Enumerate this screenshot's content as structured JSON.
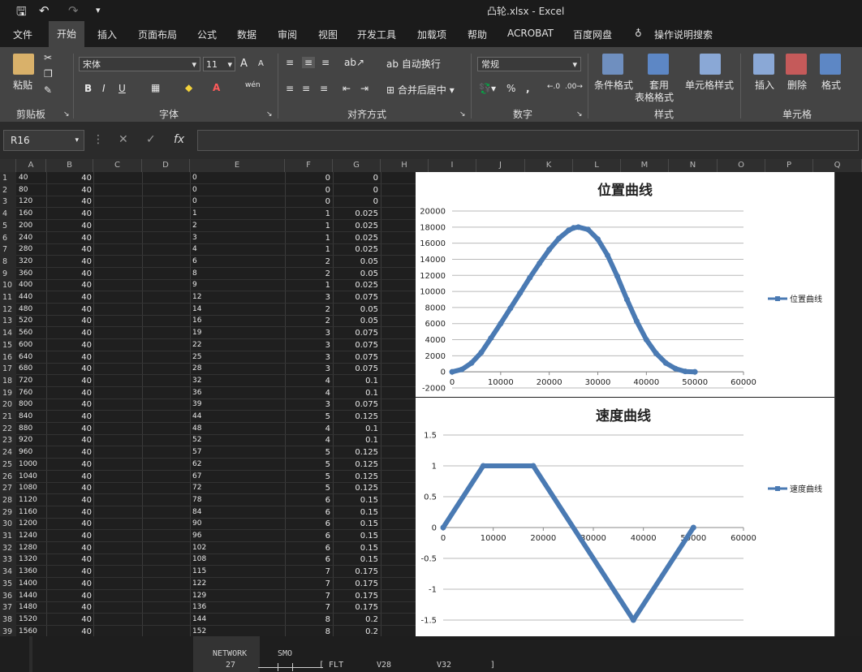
{
  "window": {
    "title": "凸轮.xlsx  -  Excel"
  },
  "tabs": [
    "文件",
    "开始",
    "插入",
    "页面布局",
    "公式",
    "数据",
    "审阅",
    "视图",
    "开发工具",
    "加载项",
    "帮助",
    "ACROBAT",
    "百度网盘",
    "操作说明搜索"
  ],
  "ribbon": {
    "clipboard": {
      "paste": "粘贴",
      "group": "剪贴板"
    },
    "font": {
      "name": "宋体",
      "size": "11",
      "group": "字体",
      "bold": "B",
      "italic": "I",
      "underline": "U",
      "grow": "A",
      "shrink": "A"
    },
    "alignment": {
      "wrap": "自动换行",
      "merge": "合并后居中",
      "group": "对齐方式"
    },
    "number": {
      "format": "常规",
      "percent": "%",
      "comma": ",",
      "group": "数字"
    },
    "styles": {
      "conditional": "条件格式",
      "table_l1": "套用",
      "table_l2": "表格格式",
      "cell_styles": "单元格样式",
      "group": "样式"
    },
    "cells": {
      "insert": "插入",
      "delete": "删除",
      "format": "格式",
      "group": "单元格"
    }
  },
  "formula_bar": {
    "name_box": "R16",
    "fx": "fx",
    "cancel": "✕",
    "enter": "✓"
  },
  "columns": [
    "A",
    "B",
    "C",
    "D",
    "E",
    "F",
    "G",
    "H",
    "I",
    "J",
    "K",
    "L",
    "M",
    "N",
    "O",
    "P",
    "Q"
  ],
  "rows": [
    {
      "n": "1",
      "a": "40",
      "b": "40",
      "e": "0",
      "f": "0",
      "g": "0"
    },
    {
      "n": "2",
      "a": "80",
      "b": "40",
      "e": "0",
      "f": "0",
      "g": "0"
    },
    {
      "n": "3",
      "a": "120",
      "b": "40",
      "e": "0",
      "f": "0",
      "g": "0"
    },
    {
      "n": "4",
      "a": "160",
      "b": "40",
      "e": "1",
      "f": "1",
      "g": "0.025"
    },
    {
      "n": "5",
      "a": "200",
      "b": "40",
      "e": "2",
      "f": "1",
      "g": "0.025"
    },
    {
      "n": "6",
      "a": "240",
      "b": "40",
      "e": "3",
      "f": "1",
      "g": "0.025"
    },
    {
      "n": "7",
      "a": "280",
      "b": "40",
      "e": "4",
      "f": "1",
      "g": "0.025"
    },
    {
      "n": "8",
      "a": "320",
      "b": "40",
      "e": "6",
      "f": "2",
      "g": "0.05"
    },
    {
      "n": "9",
      "a": "360",
      "b": "40",
      "e": "8",
      "f": "2",
      "g": "0.05"
    },
    {
      "n": "10",
      "a": "400",
      "b": "40",
      "e": "9",
      "f": "1",
      "g": "0.025"
    },
    {
      "n": "11",
      "a": "440",
      "b": "40",
      "e": "12",
      "f": "3",
      "g": "0.075"
    },
    {
      "n": "12",
      "a": "480",
      "b": "40",
      "e": "14",
      "f": "2",
      "g": "0.05"
    },
    {
      "n": "13",
      "a": "520",
      "b": "40",
      "e": "16",
      "f": "2",
      "g": "0.05"
    },
    {
      "n": "14",
      "a": "560",
      "b": "40",
      "e": "19",
      "f": "3",
      "g": "0.075"
    },
    {
      "n": "15",
      "a": "600",
      "b": "40",
      "e": "22",
      "f": "3",
      "g": "0.075"
    },
    {
      "n": "16",
      "a": "640",
      "b": "40",
      "e": "25",
      "f": "3",
      "g": "0.075"
    },
    {
      "n": "17",
      "a": "680",
      "b": "40",
      "e": "28",
      "f": "3",
      "g": "0.075"
    },
    {
      "n": "18",
      "a": "720",
      "b": "40",
      "e": "32",
      "f": "4",
      "g": "0.1"
    },
    {
      "n": "19",
      "a": "760",
      "b": "40",
      "e": "36",
      "f": "4",
      "g": "0.1"
    },
    {
      "n": "20",
      "a": "800",
      "b": "40",
      "e": "39",
      "f": "3",
      "g": "0.075"
    },
    {
      "n": "21",
      "a": "840",
      "b": "40",
      "e": "44",
      "f": "5",
      "g": "0.125"
    },
    {
      "n": "22",
      "a": "880",
      "b": "40",
      "e": "48",
      "f": "4",
      "g": "0.1"
    },
    {
      "n": "23",
      "a": "920",
      "b": "40",
      "e": "52",
      "f": "4",
      "g": "0.1"
    },
    {
      "n": "24",
      "a": "960",
      "b": "40",
      "e": "57",
      "f": "5",
      "g": "0.125"
    },
    {
      "n": "25",
      "a": "1000",
      "b": "40",
      "e": "62",
      "f": "5",
      "g": "0.125"
    },
    {
      "n": "26",
      "a": "1040",
      "b": "40",
      "e": "67",
      "f": "5",
      "g": "0.125"
    },
    {
      "n": "27",
      "a": "1080",
      "b": "40",
      "e": "72",
      "f": "5",
      "g": "0.125"
    },
    {
      "n": "28",
      "a": "1120",
      "b": "40",
      "e": "78",
      "f": "6",
      "g": "0.15"
    },
    {
      "n": "29",
      "a": "1160",
      "b": "40",
      "e": "84",
      "f": "6",
      "g": "0.15"
    },
    {
      "n": "30",
      "a": "1200",
      "b": "40",
      "e": "90",
      "f": "6",
      "g": "0.15"
    },
    {
      "n": "31",
      "a": "1240",
      "b": "40",
      "e": "96",
      "f": "6",
      "g": "0.15"
    },
    {
      "n": "32",
      "a": "1280",
      "b": "40",
      "e": "102",
      "f": "6",
      "g": "0.15"
    },
    {
      "n": "33",
      "a": "1320",
      "b": "40",
      "e": "108",
      "f": "6",
      "g": "0.15"
    },
    {
      "n": "34",
      "a": "1360",
      "b": "40",
      "e": "115",
      "f": "7",
      "g": "0.175"
    },
    {
      "n": "35",
      "a": "1400",
      "b": "40",
      "e": "122",
      "f": "7",
      "g": "0.175"
    },
    {
      "n": "36",
      "a": "1440",
      "b": "40",
      "e": "129",
      "f": "7",
      "g": "0.175"
    },
    {
      "n": "37",
      "a": "1480",
      "b": "40",
      "e": "136",
      "f": "7",
      "g": "0.175"
    },
    {
      "n": "38",
      "a": "1520",
      "b": "40",
      "e": "144",
      "f": "8",
      "g": "0.2"
    },
    {
      "n": "39",
      "a": "1560",
      "b": "40",
      "e": "152",
      "f": "8",
      "g": "0.2"
    }
  ],
  "bottom": {
    "network_label": "NETWORK",
    "network_num": "27",
    "smo": "SMO",
    "instr": "[ FLT",
    "v28": "V28",
    "v32": "V32",
    "close": "]"
  },
  "chart_data": [
    {
      "type": "line",
      "title": "位置曲线",
      "legend": "位置曲线",
      "legend_position": "right",
      "series_color": "#4a7ab3",
      "xlim": [
        0,
        60000
      ],
      "ylim": [
        -2000,
        20000
      ],
      "xticks": [
        "0",
        "10000",
        "20000",
        "30000",
        "40000",
        "50000",
        "60000"
      ],
      "yticks": [
        "-2000",
        "0",
        "2000",
        "4000",
        "6000",
        "8000",
        "10000",
        "12000",
        "14000",
        "16000",
        "18000",
        "20000"
      ],
      "grid": true,
      "x": [
        0,
        2000,
        4000,
        6000,
        8000,
        10000,
        12000,
        14000,
        16000,
        18000,
        20000,
        22000,
        24000,
        25000,
        26000,
        28000,
        30000,
        32000,
        34000,
        36000,
        38000,
        40000,
        42000,
        44000,
        46000,
        48000,
        50000
      ],
      "y": [
        0,
        300,
        1100,
        2400,
        4200,
        6000,
        7900,
        9800,
        11700,
        13500,
        15200,
        16600,
        17600,
        17900,
        18000,
        17700,
        16500,
        14500,
        11900,
        9000,
        6300,
        4000,
        2300,
        1100,
        400,
        50,
        0
      ]
    },
    {
      "type": "line",
      "title": "速度曲线",
      "legend": "速度曲线",
      "legend_position": "right",
      "series_color": "#4a7ab3",
      "xlim": [
        0,
        60000
      ],
      "ylim": [
        -1.5,
        1.5
      ],
      "xticks": [
        "0",
        "10000",
        "20000",
        "30000",
        "40000",
        "50000",
        "60000"
      ],
      "yticks": [
        "-1.5",
        "-1",
        "-0.5",
        "0",
        "0.5",
        "1",
        "1.5"
      ],
      "grid": true,
      "x": [
        0,
        8000,
        18000,
        38000,
        50000
      ],
      "y": [
        0,
        1,
        1,
        -1.5,
        0
      ]
    }
  ]
}
